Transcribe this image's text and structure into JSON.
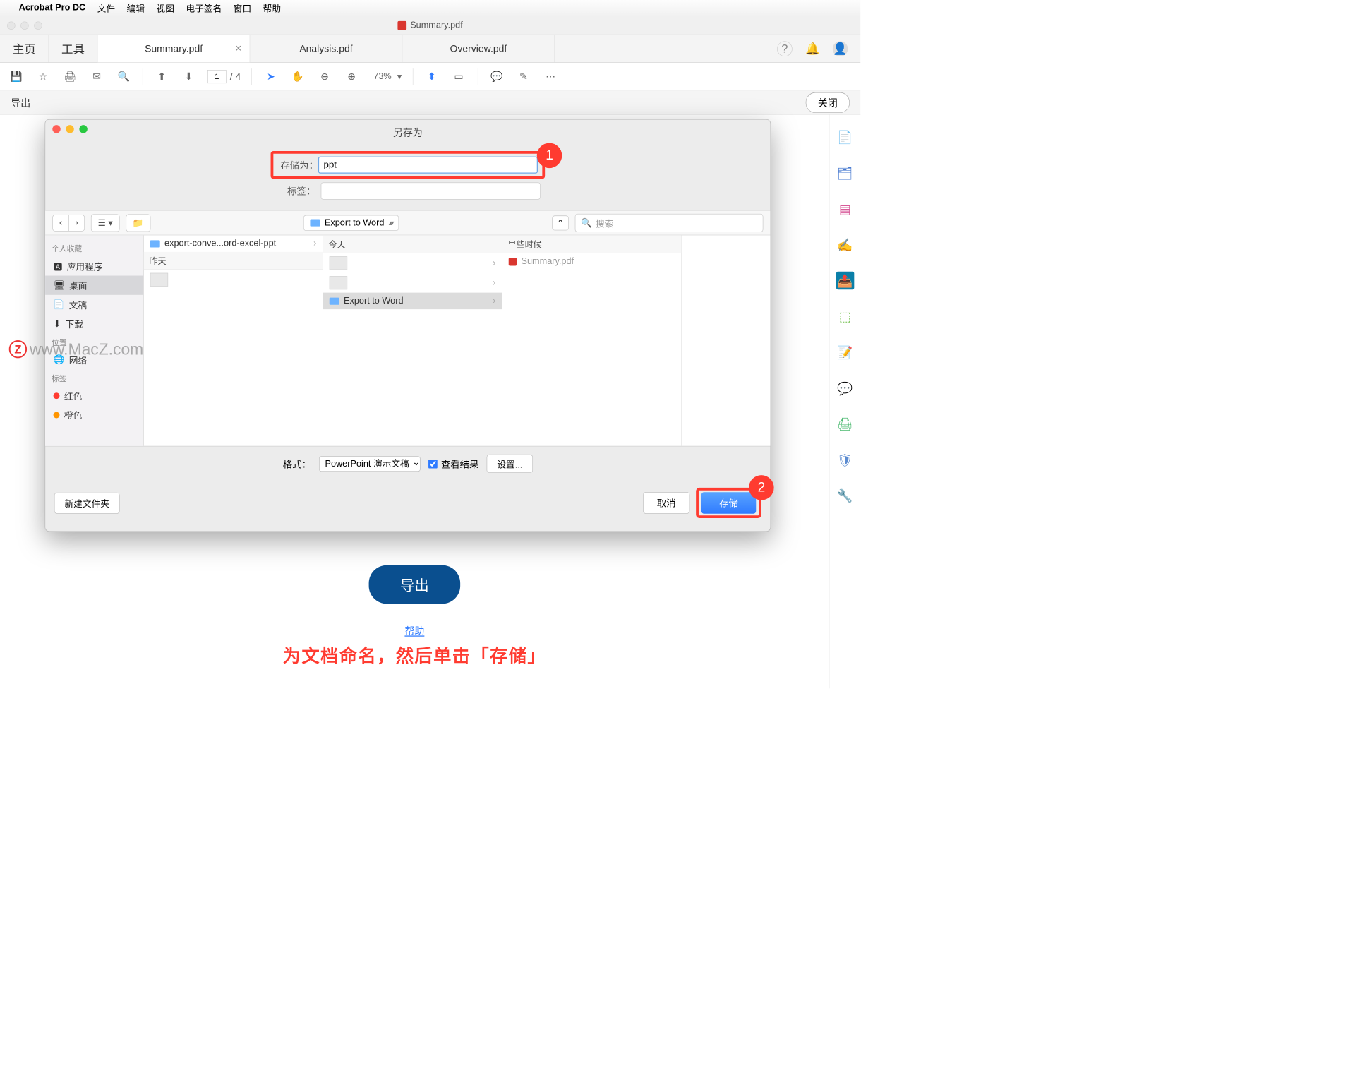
{
  "menubar": {
    "app": "Acrobat Pro DC",
    "items": [
      "文件",
      "编辑",
      "视图",
      "电子签名",
      "窗口",
      "帮助"
    ]
  },
  "window": {
    "title": "Summary.pdf"
  },
  "tabs": {
    "home": "主页",
    "tools": "工具",
    "docs": [
      {
        "label": "Summary.pdf",
        "active": true
      },
      {
        "label": "Analysis.pdf"
      },
      {
        "label": "Overview.pdf"
      }
    ]
  },
  "toolbar": {
    "page_current": "1",
    "page_total": "/ 4",
    "zoom": "73%"
  },
  "exportstrip": {
    "label": "导出",
    "close": "关闭"
  },
  "dialog": {
    "title": "另存为",
    "save_as_label": "存储为：",
    "save_as_value": "ppt",
    "tags_label": "标签：",
    "tags_value": "",
    "path": "Export to Word",
    "search_placeholder": "搜索",
    "sidebar": {
      "sections": [
        {
          "header": "个人收藏",
          "items": [
            {
              "icon": "app",
              "label": "应用程序"
            },
            {
              "icon": "desktop",
              "label": "桌面",
              "selected": true
            },
            {
              "icon": "doc",
              "label": "文稿"
            },
            {
              "icon": "down",
              "label": "下载"
            }
          ]
        },
        {
          "header": "位置",
          "items": [
            {
              "icon": "net",
              "label": "网络"
            }
          ]
        },
        {
          "header": "标签",
          "items": [
            {
              "icon": "red",
              "label": "红色"
            },
            {
              "icon": "orange",
              "label": "橙色"
            }
          ]
        }
      ]
    },
    "col1": {
      "headers": [
        "今天"
      ],
      "items": [
        {
          "thumb": true
        },
        {
          "thumb": true
        },
        {
          "folder": true,
          "label": "Export to Word",
          "selected": true
        }
      ],
      "header2": "昨天",
      "items2": [
        {
          "label": "export-conve...ord-excel-ppt",
          "chev": true
        }
      ]
    },
    "col2_header": "今天",
    "col3": {
      "header": "早些时候",
      "items": [
        {
          "pdf": true,
          "label": "Summary.pdf"
        }
      ]
    },
    "format_label": "格式：",
    "format_value": "PowerPoint 演示文稿",
    "view_result": "查看结果",
    "settings": "设置...",
    "new_folder": "新建文件夹",
    "cancel": "取消",
    "save": "存储",
    "badge1": "1",
    "badge2": "2"
  },
  "big_export": "导出",
  "help_link": "帮助",
  "caption": "为文档命名，然后单击「存储」",
  "watermark": "www.MacZ.com"
}
